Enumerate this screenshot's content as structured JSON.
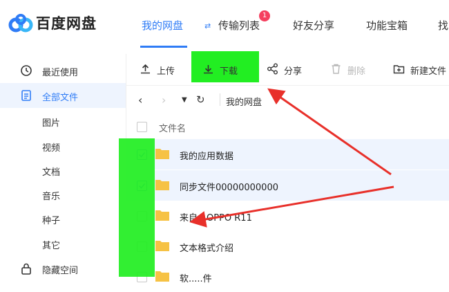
{
  "app": {
    "brand": "百度网盘",
    "accent": "#2f7cf6"
  },
  "nav": {
    "items": [
      {
        "label": "我的网盘",
        "active": true
      },
      {
        "label": "传输列表",
        "badge": "1"
      },
      {
        "label": "好友分享"
      },
      {
        "label": "功能宝箱"
      },
      {
        "label": "找"
      }
    ]
  },
  "sidebar": {
    "items": [
      {
        "label": "最近使用",
        "icon": "clock-icon"
      },
      {
        "label": "全部文件",
        "icon": "file-icon",
        "active": true
      },
      {
        "label": "图片"
      },
      {
        "label": "视频"
      },
      {
        "label": "文档"
      },
      {
        "label": "音乐"
      },
      {
        "label": "种子"
      },
      {
        "label": "其它"
      },
      {
        "label": "隐藏空间",
        "icon": "lock-icon"
      }
    ]
  },
  "toolbar": {
    "upload": "上传",
    "download": "下载",
    "share": "分享",
    "delete": "删除",
    "new_folder": "新建文件"
  },
  "path": {
    "crumb": "我的网盘"
  },
  "files": {
    "header": "文件名",
    "rows": [
      {
        "name": "我的应用数据",
        "checked": true
      },
      {
        "name": "同步文件00000000000",
        "checked": true
      },
      {
        "name": "来自：OPPO R11",
        "checked": false
      },
      {
        "name": "文本格式介绍",
        "checked": false
      },
      {
        "name": "软.....件",
        "checked": false
      }
    ]
  },
  "annotation_color": "#e8302a",
  "highlight_color": "#22ee22"
}
